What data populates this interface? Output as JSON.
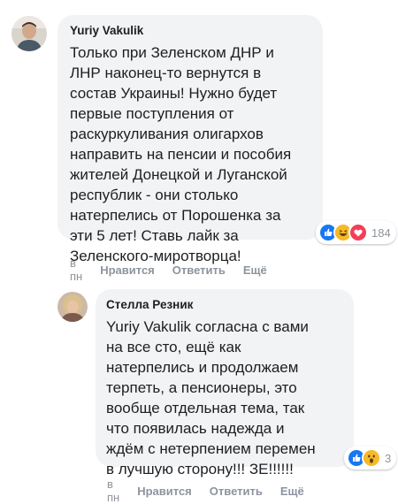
{
  "comments": [
    {
      "author": "Yuriy Vakulik",
      "text": "Только при Зеленском ДНР и\nЛНР наконец-то вернутся в\nсостав Украины! Нужно будет\nпервые поступления от\nраскуркуливания олигархов\nнаправить на пенсии и пособия\nжителей Донецкой и Луганской\nреспублик - они столько\nнатерпелись от Порошенка за\nэти 5 лет! Ставь лайк за\nЗеленского-миротворца!",
      "reactions": [
        "like-icon",
        "haha-icon",
        "love-icon"
      ],
      "reaction_count": "184",
      "time": "в пн",
      "like_label": "Нравится",
      "reply_label": "Ответить",
      "more_label": "Ещё"
    },
    {
      "author": "Стелла Резник",
      "text": "Yuriy Vakulik согласна с вами\nна все сто, ещё как\nнатерпелись и продолжаем\nтерпеть, а пенсионеры, это\nвообще отдельная тема, так\nчто появилась надежда и\nждём с нетерпением перемен\nв лучшую сторону!!! ЗЕ!!!!!!",
      "reactions": [
        "like-icon",
        "wow-icon"
      ],
      "reaction_count": "3",
      "time": "в пн",
      "like_label": "Нравится",
      "reply_label": "Ответить",
      "more_label": "Ещё"
    }
  ],
  "colors": {
    "like": "#1877f2",
    "love": "#f33e58",
    "haha": "#f7b928",
    "bubble": "#f2f3f5",
    "meta": "#90949c"
  }
}
